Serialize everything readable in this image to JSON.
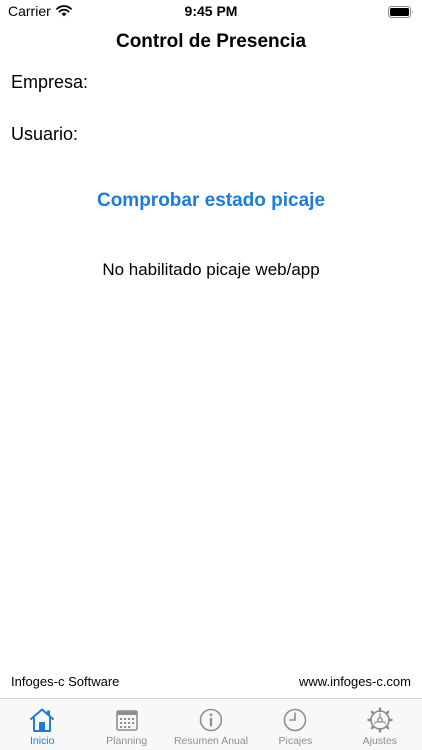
{
  "status_bar": {
    "carrier": "Carrier",
    "time": "9:45 PM",
    "icons": [
      "wifi-icon",
      "battery-icon"
    ]
  },
  "nav": {
    "title": "Control de Presencia"
  },
  "fields": {
    "company_label": "Empresa:",
    "user_label": "Usuario:"
  },
  "actions": {
    "check_status": "Comprobar estado picaje"
  },
  "message": "No habilitado picaje web/app",
  "footer": {
    "left": "Infoges-c Software",
    "right": "www.infoges-c.com"
  },
  "tabs": [
    {
      "label": "Inicio",
      "icon": "home-icon",
      "active": true
    },
    {
      "label": "Planning",
      "icon": "calendar-icon",
      "active": false
    },
    {
      "label": "Resumen Anual",
      "icon": "info-icon",
      "active": false
    },
    {
      "label": "Picajes",
      "icon": "clock-icon",
      "active": false
    },
    {
      "label": "Ajustes",
      "icon": "gear-icon",
      "active": false
    }
  ],
  "colors": {
    "accent": "#1b7ddb",
    "inactive": "#8e8e93"
  }
}
